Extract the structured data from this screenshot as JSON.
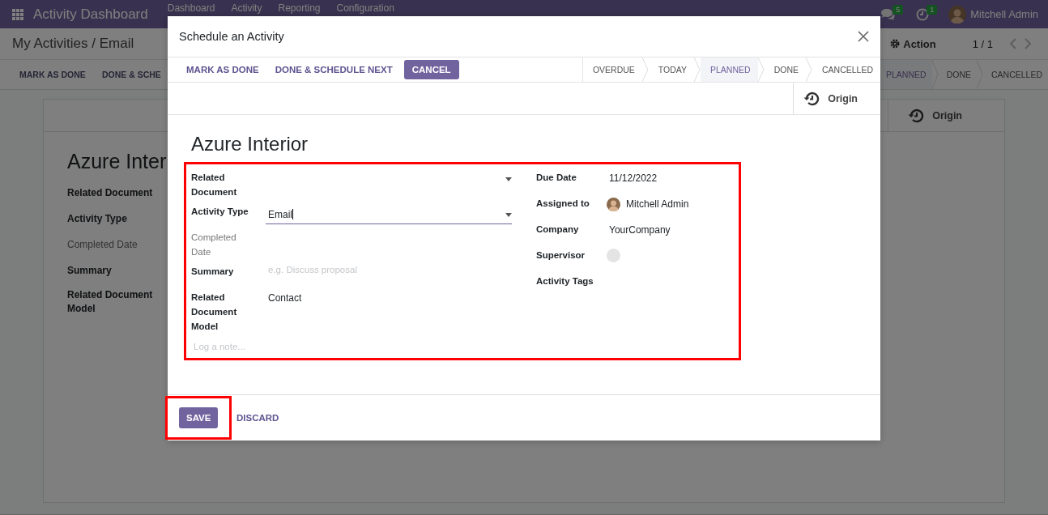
{
  "navbar": {
    "app_title": "Activity Dashboard",
    "menu": [
      "Dashboard",
      "Activity",
      "Reporting",
      "Configuration"
    ],
    "messages_badge": "5",
    "activities_badge": "1",
    "user": "Mitchell Admin"
  },
  "control_panel": {
    "breadcrumb": "My Activities / Email",
    "action": "Action",
    "pager": "1 / 1",
    "buttons": [
      "MARK AS DONE",
      "DONE & SCHE"
    ],
    "stages": [
      {
        "label": "PLANNED",
        "selected": true
      },
      {
        "label": "DONE",
        "selected": false
      },
      {
        "label": "CANCELLED",
        "selected": false
      }
    ]
  },
  "form": {
    "origin": "Origin",
    "title": "Azure Inter",
    "labels": [
      {
        "text": "Related Document",
        "muted": false
      },
      {
        "text": "Activity Type",
        "muted": false
      },
      {
        "text": "Completed Date",
        "muted": true
      },
      {
        "text": "Summary",
        "muted": false
      },
      {
        "text": "Related Document Model",
        "muted": false
      }
    ]
  },
  "dialog": {
    "title": "Schedule an Activity",
    "actions": [
      {
        "label": "MARK AS DONE",
        "kind": "link"
      },
      {
        "label": "DONE & SCHEDULE NEXT",
        "kind": "link"
      },
      {
        "label": "CANCEL",
        "kind": "primary"
      }
    ],
    "stages": [
      {
        "label": "OVERDUE",
        "selected": false
      },
      {
        "label": "TODAY",
        "selected": false
      },
      {
        "label": "PLANNED",
        "selected": true
      },
      {
        "label": "DONE",
        "selected": false
      },
      {
        "label": "CANCELLED",
        "selected": false
      }
    ],
    "origin": "Origin",
    "record": "Azure Interior",
    "left_fields": [
      {
        "label": "Related Document",
        "kind": "select",
        "muted": false,
        "focused": false
      },
      {
        "label": "Activity Type",
        "kind": "select",
        "muted": false,
        "focused": true,
        "value": "Email"
      },
      {
        "label": "Completed Date",
        "kind": "text",
        "muted": true
      },
      {
        "label": "Summary",
        "kind": "input",
        "muted": false,
        "placeholder": "e.g. Discuss proposal"
      },
      {
        "label": "Related Document Model",
        "kind": "text",
        "muted": false,
        "value": "Contact"
      }
    ],
    "note": {
      "placeholder": "Log a note..."
    },
    "right_fields": [
      {
        "label": "Due Date",
        "kind": "text",
        "value": "11/12/2022"
      },
      {
        "label": "Assigned to",
        "kind": "user",
        "value": "Mitchell Admin"
      },
      {
        "label": "Company",
        "kind": "text",
        "value": "YourCompany"
      },
      {
        "label": "Supervisor",
        "kind": "avatar"
      },
      {
        "label": "Activity Tags",
        "kind": "text"
      }
    ],
    "footer": [
      {
        "label": "SAVE",
        "kind": "primary"
      },
      {
        "label": "DISCARD",
        "kind": "link"
      }
    ]
  }
}
